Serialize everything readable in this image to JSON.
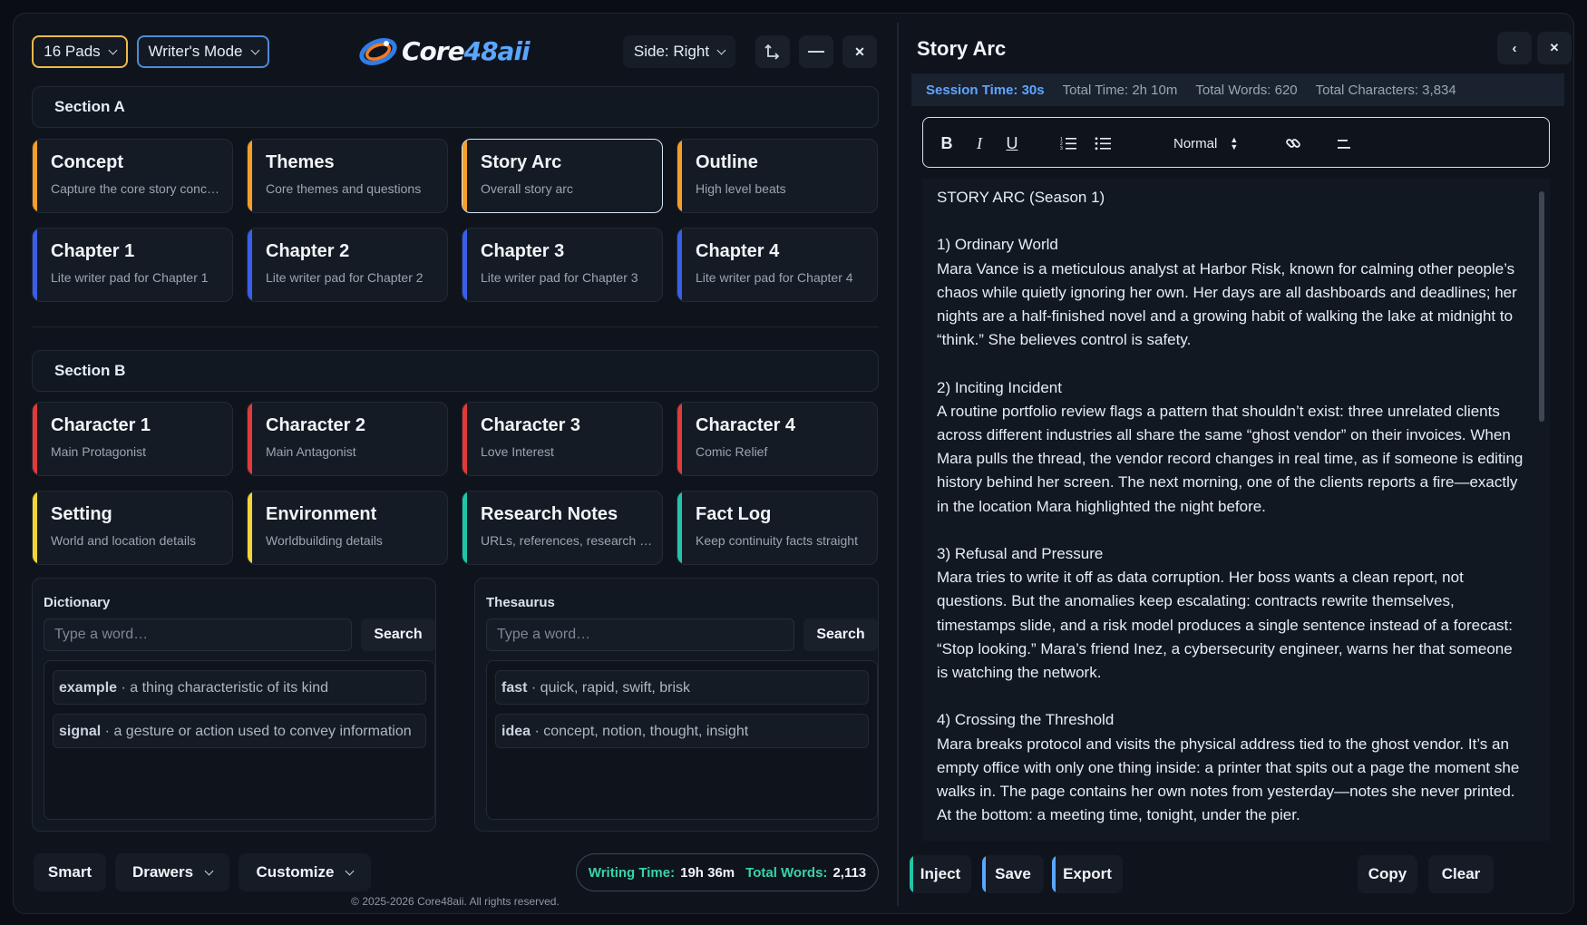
{
  "toolbar": {
    "pads_label": "16 Pads",
    "mode_label": "Writer's Mode",
    "side_label": "Side: Right",
    "logo_part1": "Core",
    "logo_part2": "48aii"
  },
  "sections": {
    "a_title": "Section A",
    "b_title": "Section B"
  },
  "pads": [
    {
      "title": "Concept",
      "subtitle": "Capture the core story concept",
      "color": "#f59e2a"
    },
    {
      "title": "Themes",
      "subtitle": "Core themes and questions",
      "color": "#f59e2a"
    },
    {
      "title": "Story Arc",
      "subtitle": "Overall story arc",
      "color": "#f59e2a",
      "active": true
    },
    {
      "title": "Outline",
      "subtitle": "High level beats",
      "color": "#f59e2a"
    },
    {
      "title": "Chapter 1",
      "subtitle": "Lite writer pad for Chapter 1",
      "color": "#3b5ee8"
    },
    {
      "title": "Chapter 2",
      "subtitle": "Lite writer pad for Chapter 2",
      "color": "#3b5ee8"
    },
    {
      "title": "Chapter 3",
      "subtitle": "Lite writer pad for Chapter 3",
      "color": "#3b5ee8"
    },
    {
      "title": "Chapter 4",
      "subtitle": "Lite writer pad for Chapter 4",
      "color": "#3b5ee8"
    },
    {
      "title": "Character 1",
      "subtitle": "Main Protagonist",
      "color": "#e03a3a"
    },
    {
      "title": "Character 2",
      "subtitle": "Main Antagonist",
      "color": "#e03a3a"
    },
    {
      "title": "Character 3",
      "subtitle": "Love Interest",
      "color": "#e03a3a"
    },
    {
      "title": "Character 4",
      "subtitle": "Comic Relief",
      "color": "#e03a3a"
    },
    {
      "title": "Setting",
      "subtitle": "World and location details",
      "color": "#f2d43a"
    },
    {
      "title": "Environment",
      "subtitle": "Worldbuilding details",
      "color": "#f2d43a"
    },
    {
      "title": "Research Notes",
      "subtitle": "URLs, references, research notes",
      "color": "#22c4a8"
    },
    {
      "title": "Fact Log",
      "subtitle": "Keep continuity facts straight",
      "color": "#22c4a8"
    }
  ],
  "dictionary": {
    "label": "Dictionary",
    "placeholder": "Type a word…",
    "search_label": "Search",
    "results": [
      {
        "word": "example",
        "def": "a thing characteristic of its kind"
      },
      {
        "word": "signal",
        "def": "a gesture or action used to convey information"
      }
    ]
  },
  "thesaurus": {
    "label": "Thesaurus",
    "placeholder": "Type a word…",
    "search_label": "Search",
    "results": [
      {
        "word": "fast",
        "def": "quick, rapid, swift, brisk"
      },
      {
        "word": "idea",
        "def": "concept, notion, thought, insight"
      }
    ]
  },
  "bottom": {
    "smart_label": "Smart",
    "drawers_label": "Drawers",
    "customize_label": "Customize",
    "writing_time_label": "Writing Time:",
    "writing_time_value": "19h 36m",
    "total_words_label": "Total Words:",
    "total_words_value": "2,113",
    "copyright": "© 2025-2026 Core48aii. All rights reserved."
  },
  "editor": {
    "title": "Story Arc",
    "session_time": "Session Time: 30s",
    "total_time": "Total Time: 2h 10m",
    "total_words": "Total Words: 620",
    "total_chars": "Total Characters: 3,834",
    "format_label": "Normal",
    "content": "STORY ARC (Season 1)\n\n1) Ordinary World\nMara Vance is a meticulous analyst at Harbor Risk, known for calming other people’s chaos while quietly ignoring her own. Her days are all dashboards and deadlines; her nights are a half-finished novel and a growing habit of walking the lake at midnight to “think.” She believes control is safety.\n\n2) Inciting Incident\nA routine portfolio review flags a pattern that shouldn’t exist: three unrelated clients across different industries all share the same “ghost vendor” on their invoices. When Mara pulls the thread, the vendor record changes in real time, as if someone is editing history behind her screen. The next morning, one of the clients reports a fire—exactly in the location Mara highlighted the night before.\n\n3) Refusal and Pressure\nMara tries to write it off as data corruption. Her boss wants a clean report, not questions. But the anomalies keep escalating: contracts rewrite themselves, timestamps slide, and a risk model produces a single sentence instead of a forecast: “Stop looking.” Mara’s friend Inez, a cybersecurity engineer, warns her that someone is watching the network.\n\n4) Crossing the Threshold\nMara breaks protocol and visits the physical address tied to the ghost vendor. It’s an empty office with only one thing inside: a printer that spits out a page the moment she walks in. The page contains her own notes from yesterday—notes she never printed. At the bottom: a meeting time, tonight, under the pier.",
    "inject_label": "Inject",
    "save_label": "Save",
    "export_label": "Export",
    "copy_label": "Copy",
    "clear_label": "Clear"
  },
  "colors": {
    "accent_orange": "#f59e2a",
    "accent_blue": "#3b5ee8",
    "accent_red": "#e03a3a",
    "accent_yellow": "#f2d43a",
    "accent_teal": "#22c4a8",
    "stat_green": "#3ad3a8",
    "session_blue": "#5fa5ff"
  },
  "icons": {
    "logo": "swirl-logo-icon",
    "dock": "corner-arrow-icon",
    "minimize": "minimize-icon",
    "close": "close-icon",
    "collapse": "chevron-left-icon"
  }
}
